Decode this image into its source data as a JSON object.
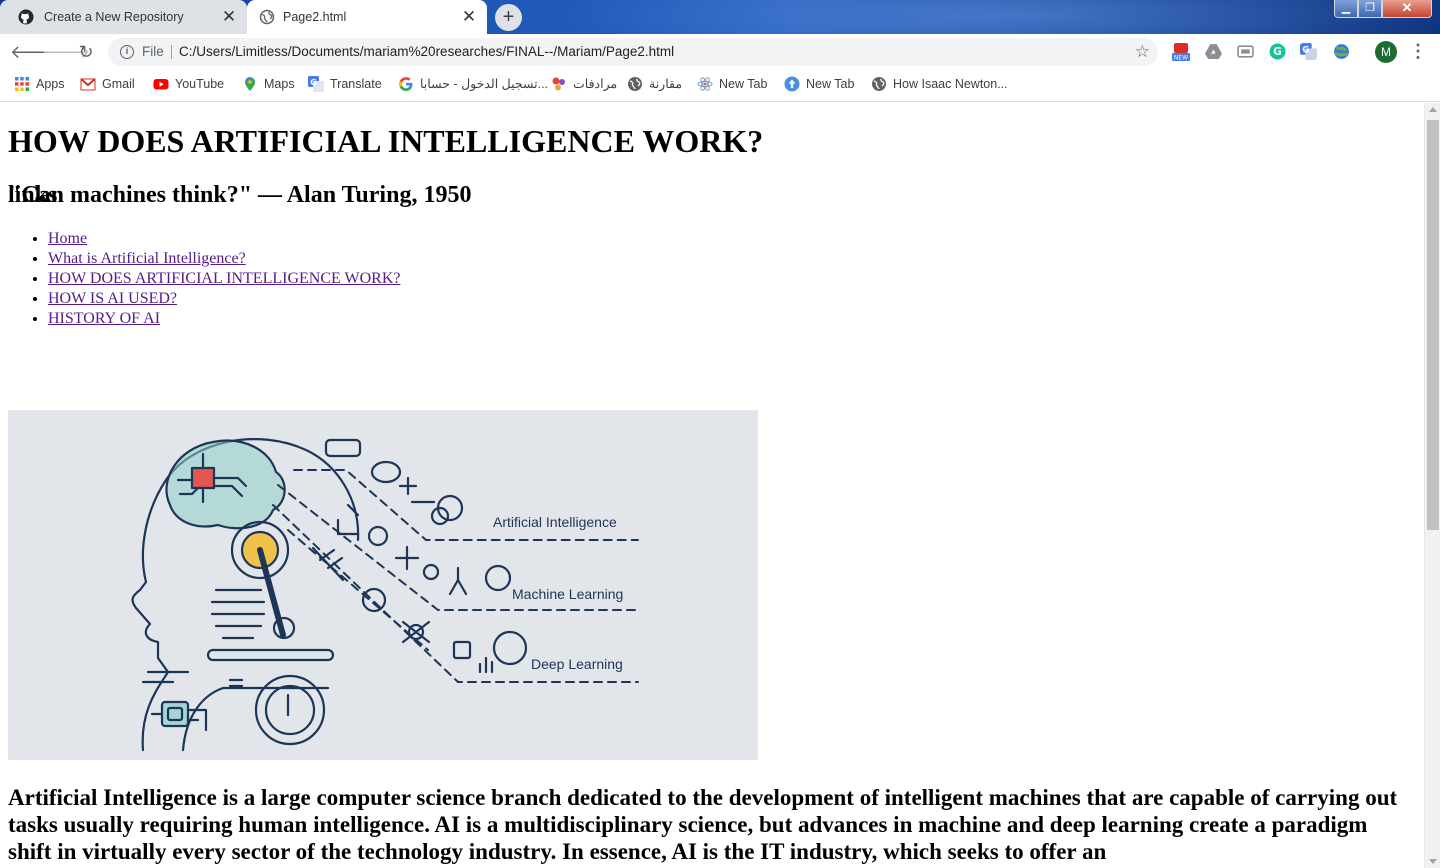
{
  "browser": {
    "tabs": [
      {
        "title": "Create a New Repository",
        "icon": "github-icon",
        "active": false
      },
      {
        "title": "Page2.html",
        "icon": "globe-icon",
        "active": true
      }
    ],
    "address": {
      "scheme_label": "File",
      "url": "C:/Users/Limitless/Documents/mariam%20researches/FINAL--/Mariam/Page2.html"
    },
    "extensions": [
      {
        "name": "extension-new-icon",
        "badge": "NEW",
        "color": "#d93025"
      },
      {
        "name": "drive-icon",
        "color": "#8a8f95"
      },
      {
        "name": "cast-icon",
        "color": "#8a8f95"
      },
      {
        "name": "grammarly-icon",
        "color": "#15c39a"
      },
      {
        "name": "translate-extension-icon",
        "color": "#4a7be8"
      },
      {
        "name": "globe-extension-icon",
        "color": "#4b8f32"
      }
    ],
    "profile_initial": "M",
    "profile_color": "#1e6b34"
  },
  "bookmarks": [
    {
      "label": "Apps",
      "icon": "apps-grid-icon"
    },
    {
      "label": "Gmail",
      "icon": "gmail-icon"
    },
    {
      "label": "YouTube",
      "icon": "youtube-icon"
    },
    {
      "label": "Maps",
      "icon": "maps-pin-icon"
    },
    {
      "label": "Translate",
      "icon": "translate-icon"
    },
    {
      "label": "تسجيل الدخول - حسابا...",
      "icon": "google-icon"
    },
    {
      "label": "مرادفات",
      "icon": "synonyms-icon"
    },
    {
      "label": "مقارنة",
      "icon": "globe-icon"
    },
    {
      "label": "New Tab",
      "icon": "atom-icon"
    },
    {
      "label": "New Tab",
      "icon": "upload-arrow-icon"
    },
    {
      "label": "How Isaac Newton...",
      "icon": "globe-icon"
    }
  ],
  "page": {
    "heading": "HOW DOES ARTIFICIAL INTELLIGENCE WORK?",
    "links_heading": "links",
    "nav_links": [
      "Home",
      "What is Artificial Intelligence?",
      "HOW DOES ARTIFICIAL INTELLIGENCE WORK?",
      "HOW IS AI USED?",
      "HISTORY OF AI"
    ],
    "quote": "\"Can machines think?\" — Alan Turing, 1950",
    "hero_image": {
      "labels": [
        "Artificial Intelligence",
        "Machine Learning",
        "Deep Learning"
      ],
      "background": "#e2e5e9",
      "line_color": "#1d3557",
      "teal": "#8ecfc9",
      "accent_yellow": "#f1c24b",
      "accent_red": "#e0574f"
    },
    "article_text": "Artificial Intelligence is a large computer science branch dedicated to the development of intelligent machines that are capable of carrying out tasks usually requiring human intelligence. AI is a multidisciplinary science, but advances in machine and deep learning create a paradigm shift in virtually every sector of the technology industry. In essence, AI is the IT industry, which seeks to offer an"
  }
}
